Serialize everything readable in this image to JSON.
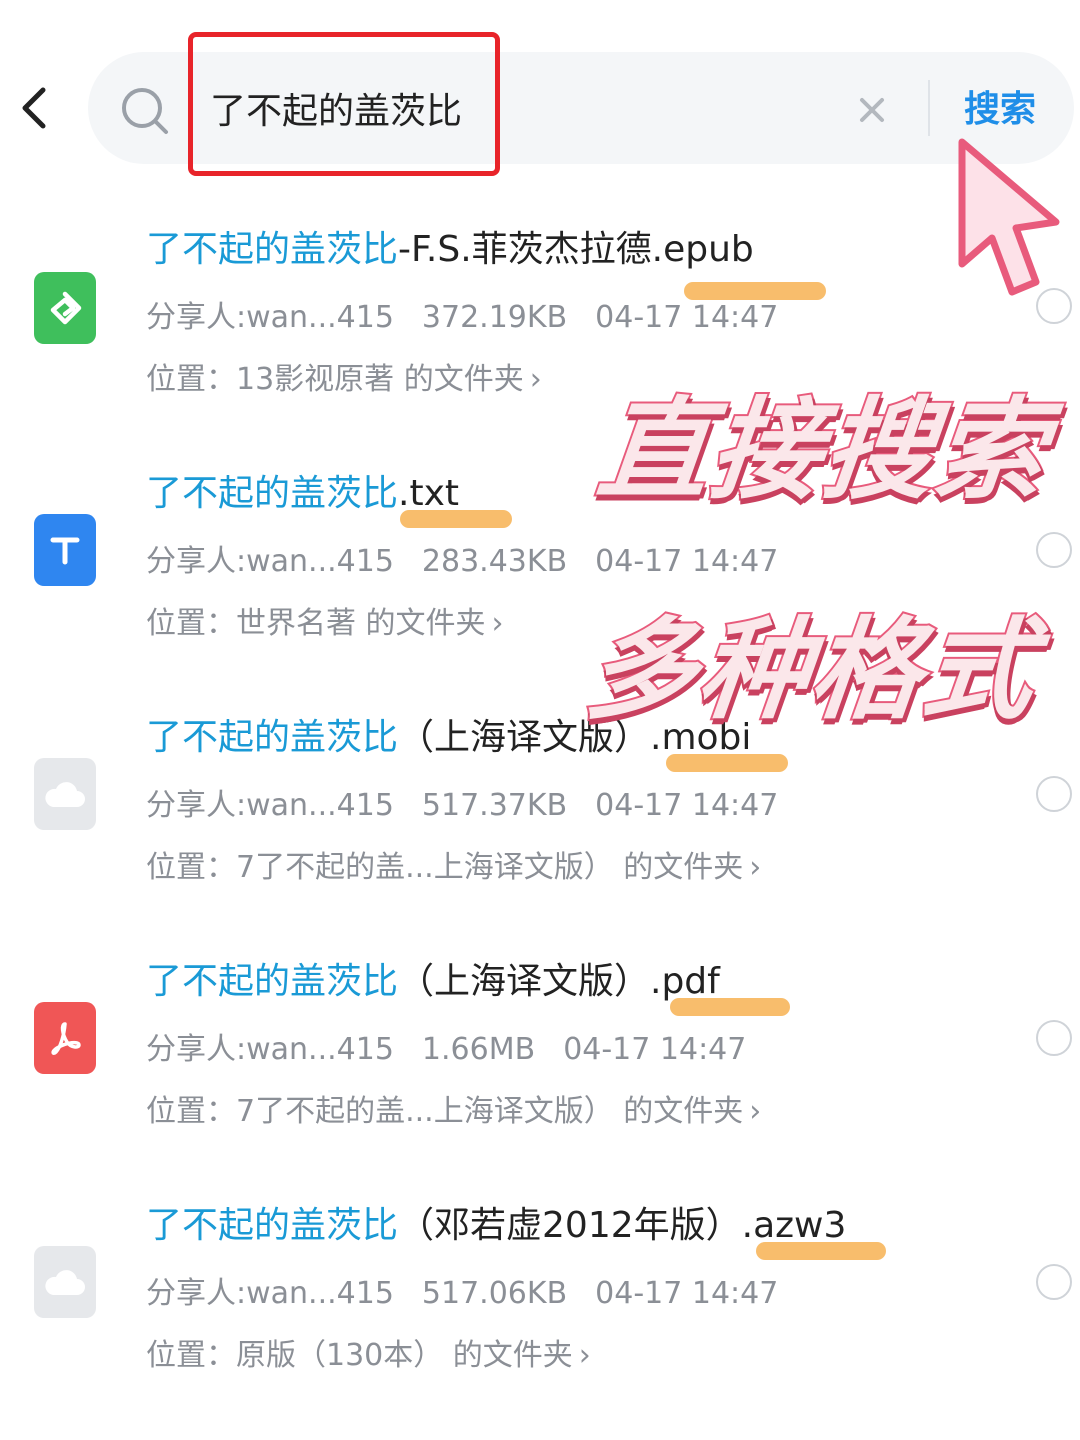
{
  "search": {
    "query": "了不起的盖茨比",
    "clear_label": "×",
    "submit_label": "搜索"
  },
  "annotations": {
    "sticker_1": "直接搜索",
    "sticker_2": "多种格式"
  },
  "colors": {
    "keyword": "#1a9ad6",
    "search_button": "#1f8ee8",
    "highlight_border": "#e8242a",
    "underline": "#f7b152",
    "sticker_fill": "#fbe7ea",
    "sticker_stroke": "#e85b7c"
  },
  "files": [
    {
      "icon": "epub-icon",
      "keyword": "了不起的盖茨比",
      "rest": "-F.S.菲茨杰拉德.epub",
      "sharer": "分享人:wan...415",
      "size": "372.19KB",
      "time": "04-17 14:47",
      "location": "位置：13影视原著 的文件夹"
    },
    {
      "icon": "txt-icon",
      "keyword": "了不起的盖茨比",
      "rest": ".txt",
      "sharer": "分享人:wan...415",
      "size": "283.43KB",
      "time": "04-17 14:47",
      "location": "位置：世界名著 的文件夹"
    },
    {
      "icon": "cloud-file-icon",
      "keyword": "了不起的盖茨比",
      "rest": "（上海译文版）.mobi",
      "sharer": "分享人:wan...415",
      "size": "517.37KB",
      "time": "04-17 14:47",
      "location": "位置：7了不起的盖...上海译文版） 的文件夹"
    },
    {
      "icon": "pdf-icon",
      "keyword": "了不起的盖茨比",
      "rest": "（上海译文版）.pdf",
      "sharer": "分享人:wan...415",
      "size": "1.66MB",
      "time": "04-17 14:47",
      "location": "位置：7了不起的盖...上海译文版） 的文件夹"
    },
    {
      "icon": "cloud-file-icon",
      "keyword": "了不起的盖茨比",
      "rest": "（邓若虚2012年版）.azw3",
      "sharer": "分享人:wan...415",
      "size": "517.06KB",
      "time": "04-17 14:47",
      "location": "位置：原版（130本） 的文件夹"
    }
  ]
}
